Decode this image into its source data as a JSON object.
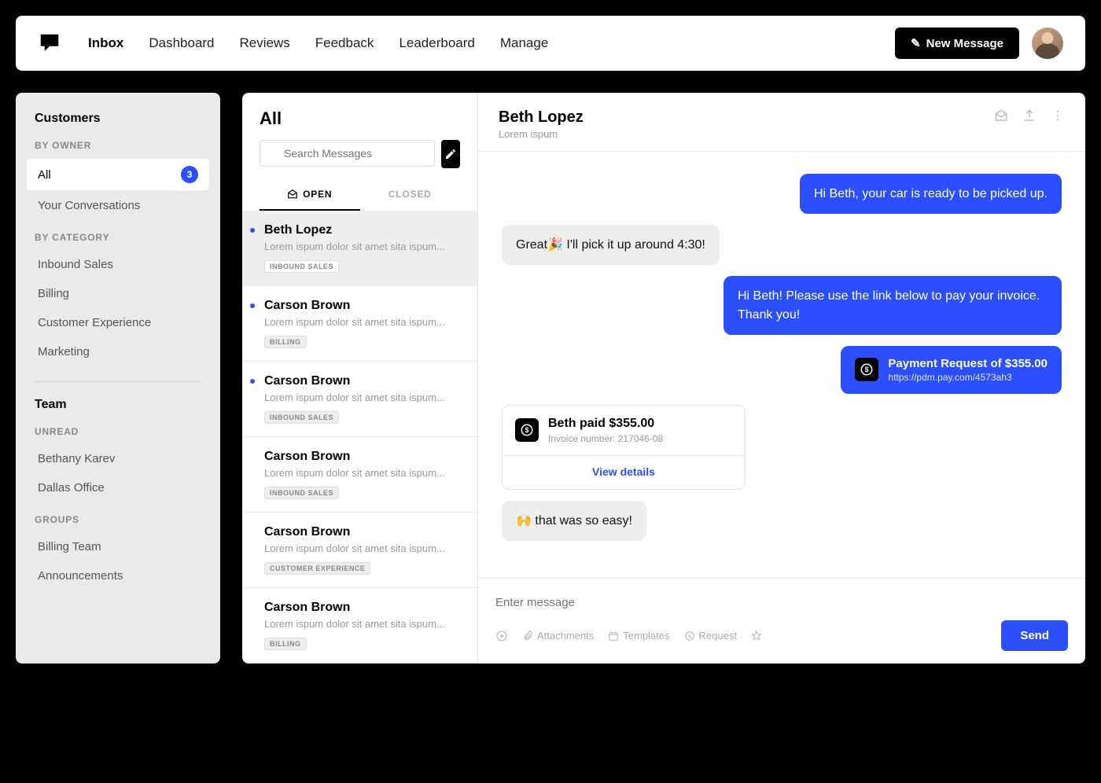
{
  "nav": {
    "items": [
      "Inbox",
      "Dashboard",
      "Reviews",
      "Feedback",
      "Leaderboard",
      "Manage"
    ],
    "active": "Inbox",
    "newMessage": "New Message"
  },
  "sidebar": {
    "customers": {
      "title": "Customers",
      "byOwnerLabel": "BY OWNER",
      "owner": [
        {
          "label": "All",
          "badge": "3",
          "active": true
        },
        {
          "label": "Your Conversations"
        }
      ],
      "byCategoryLabel": "BY CATEGORY",
      "category": [
        {
          "label": "Inbound Sales"
        },
        {
          "label": "Billing"
        },
        {
          "label": "Customer Experience"
        },
        {
          "label": "Marketing"
        }
      ]
    },
    "team": {
      "title": "Team",
      "unreadLabel": "UNREAD",
      "unread": [
        {
          "label": "Bethany Karev"
        },
        {
          "label": "Dallas Office"
        }
      ],
      "groupsLabel": "GROUPS",
      "groups": [
        {
          "label": "Billing Team"
        },
        {
          "label": "Announcements"
        }
      ]
    }
  },
  "msglist": {
    "title": "All",
    "searchPlaceholder": "Search Messages",
    "tabs": {
      "open": "OPEN",
      "closed": "CLOSED"
    },
    "conversations": [
      {
        "name": "Beth Lopez",
        "preview": "Lorem ispum dolor sit amet sita ispum...",
        "tag": "INBOUND SALES",
        "unread": true,
        "selected": true
      },
      {
        "name": "Carson Brown",
        "preview": "Lorem ispum dolor sit amet sita ispum...",
        "tag": "BILLING",
        "unread": true
      },
      {
        "name": "Carson Brown",
        "preview": "Lorem ispum dolor sit amet sita ispum...",
        "tag": "INBOUND SALES",
        "unread": true
      },
      {
        "name": "Carson Brown",
        "preview": "Lorem ispum dolor sit amet sita ispum...",
        "tag": "INBOUND SALES"
      },
      {
        "name": "Carson Brown",
        "preview": "Lorem ispum dolor sit amet sita ispum...",
        "tag": "CUSTOMER EXPERIENCE"
      },
      {
        "name": "Carson Brown",
        "preview": "Lorem ispum dolor sit amet sita ispum...",
        "tag": "BILLING"
      }
    ]
  },
  "thread": {
    "name": "Beth Lopez",
    "subtitle": "Lorem ispum",
    "messages": [
      {
        "type": "out",
        "text": "Hi Beth, your car is ready to be picked up."
      },
      {
        "type": "in",
        "text": "Great🎉 I'll pick it up around 4:30!"
      },
      {
        "type": "out",
        "text": "Hi Beth! Please use the link below to pay your invoice. Thank you!"
      },
      {
        "type": "payment",
        "title": "Payment Request of $355.00",
        "url": "https://pdm.pay.com/4573ah3"
      },
      {
        "type": "receipt",
        "title": "Beth paid $355.00",
        "sub": "Invoice number: 217046-08",
        "action": "View details"
      },
      {
        "type": "in",
        "text": "🙌 that was so easy!"
      }
    ]
  },
  "composer": {
    "placeholder": "Enter message",
    "attachments": "Attachments",
    "templates": "Templates",
    "request": "Request",
    "send": "Send"
  }
}
